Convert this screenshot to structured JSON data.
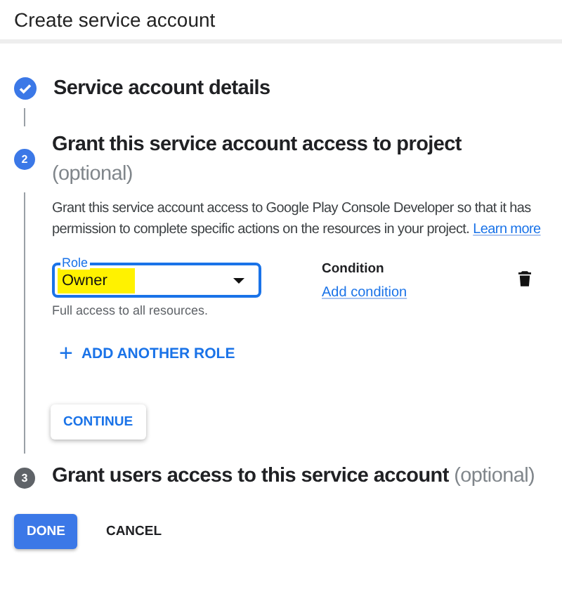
{
  "window": {
    "title": "Create service account"
  },
  "steps": [
    {
      "title": "Service account details",
      "completed": true,
      "selected": false
    },
    {
      "number": "2",
      "title": "Grant this service account access to project",
      "optional": "(optional)",
      "completed": false,
      "selected": true,
      "description": "Grant this service account access to Google Play Console Developer so that it has permission to complete specific actions on the resources in your project.",
      "learn_more": "Learn more",
      "role_field": {
        "label": "Role",
        "value": "Owner",
        "highlighted": true,
        "helper": "Full access to all resources."
      },
      "condition": {
        "heading": "Condition",
        "link": "Add condition"
      },
      "add_role": {
        "icon": "+",
        "label": "ADD ANOTHER ROLE"
      },
      "continue": "CONTINUE"
    },
    {
      "number": "3",
      "title": "Grant users access to this service account",
      "optional": "(optional)",
      "completed": false,
      "selected": false
    }
  ],
  "buttons": {
    "done": "DONE",
    "cancel": "CANCEL"
  }
}
